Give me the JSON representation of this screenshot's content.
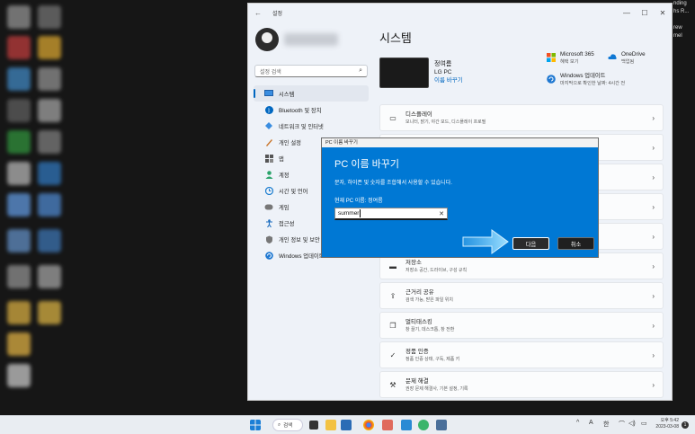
{
  "window": {
    "title": "설정",
    "back": "←",
    "minimize": "—",
    "maximize": "☐",
    "close": "✕"
  },
  "sidebar": {
    "search_placeholder": "설정 검색",
    "items": [
      {
        "label": "시스템",
        "icon": "monitor-icon"
      },
      {
        "label": "Bluetooth 및 장치",
        "icon": "bluetooth-icon"
      },
      {
        "label": "네트워크 및 인터넷",
        "icon": "wifi-icon"
      },
      {
        "label": "개인 설정",
        "icon": "brush-icon"
      },
      {
        "label": "앱",
        "icon": "apps-icon"
      },
      {
        "label": "계정",
        "icon": "person-icon"
      },
      {
        "label": "시간 및 언어",
        "icon": "globe-clock-icon"
      },
      {
        "label": "게임",
        "icon": "gamepad-icon"
      },
      {
        "label": "접근성",
        "icon": "accessibility-icon"
      },
      {
        "label": "개인 정보 및 보안",
        "icon": "shield-icon"
      },
      {
        "label": "Windows 업데이트",
        "icon": "update-icon"
      }
    ]
  },
  "main": {
    "page_title": "시스템",
    "device": {
      "name": "정여름",
      "model": "LG PC",
      "rename_link": "이름 바꾸기"
    },
    "quick": {
      "ms365_title": "Microsoft 365",
      "ms365_sub": "혜택 보기",
      "onedrive_title": "OneDrive",
      "onedrive_sub": "백업됨",
      "update_title": "Windows 업데이트",
      "update_sub": "마지막으로 확인한 날짜: 4시간 전"
    },
    "cards": [
      {
        "title": "디스플레이",
        "sub": "모니터, 밝기, 야간 모드, 디스플레이 프로필",
        "icon": "display-icon"
      },
      {
        "title": "",
        "sub": "",
        "icon": ""
      },
      {
        "title": "",
        "sub": "",
        "icon": ""
      },
      {
        "title": "",
        "sub": "",
        "icon": ""
      },
      {
        "title": "",
        "sub": "",
        "icon": ""
      },
      {
        "title": "저장소",
        "sub": "저장소 공간, 드라이브, 구성 규칙",
        "icon": "storage-icon"
      },
      {
        "title": "근거리 공유",
        "sub": "검색 가능, 받은 파일 위치",
        "icon": "share-icon"
      },
      {
        "title": "멀티태스킹",
        "sub": "창 끌기, 데스크톱, 창 전환",
        "icon": "multitask-icon"
      },
      {
        "title": "정품 인증",
        "sub": "정품 인증 상태, 구독, 제품 키",
        "icon": "check-circle-icon"
      },
      {
        "title": "문제 해결",
        "sub": "권장 문제 해결사, 기본 설정, 기록",
        "icon": "wrench-icon"
      }
    ]
  },
  "dialog": {
    "window_title": "PC 이름 바꾸기",
    "title": "PC 이름 바꾸기",
    "description": "문자, 하이픈 및 숫자를 조합해서 사용할 수 있습니다.",
    "current_name": "현재 PC 이름: 정여름",
    "input_value": "summer",
    "clear_glyph": "✕",
    "next_label": "다음",
    "cancel_label": "취소"
  },
  "right_edge_text": "nding\nhs R...\n\nrew\nmel",
  "taskbar": {
    "search_label": "검색",
    "tray_caret": "^",
    "tray_ime_a": "A",
    "tray_ime_han": "한",
    "time": "오후 5:42",
    "date": "2023-03-08",
    "notification_count": "1"
  },
  "colors": {
    "accent": "#0078d4",
    "dialog_bg": "#0078d4",
    "settings_bg": "#eef2f8"
  }
}
